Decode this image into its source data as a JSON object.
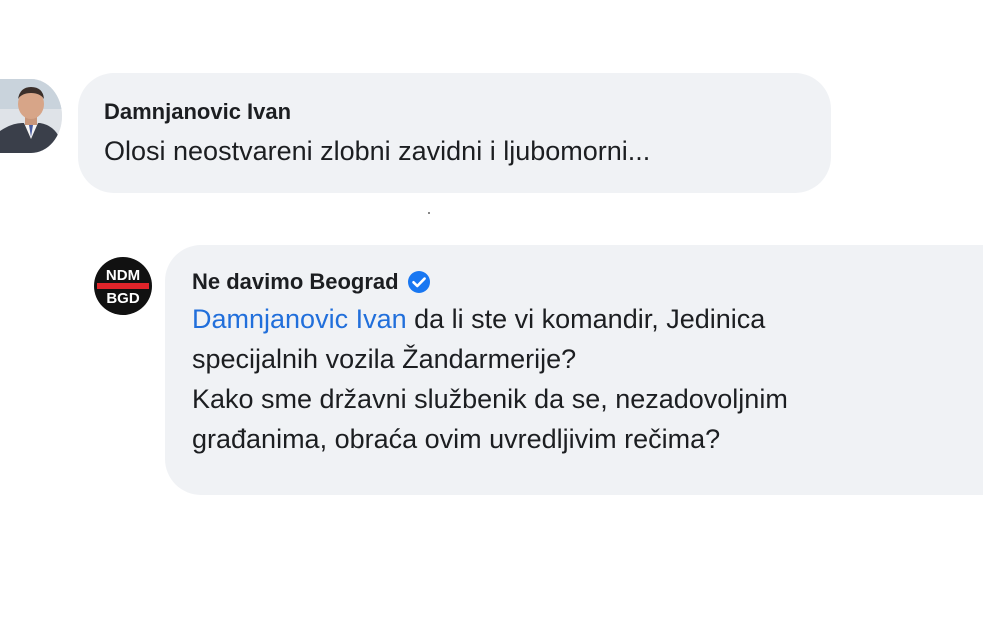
{
  "comments": [
    {
      "author": "Damnjanovic Ivan",
      "text": "Olosi neostvareni zlobni zavidni i ljubomorni..."
    },
    {
      "author": "Ne davimo Beograd",
      "verified": true,
      "avatar_text": [
        "NDM",
        "BGD"
      ],
      "mention": "Damnjanovic Ivan",
      "line1_rest": " da li ste vi komandir, Jedinica",
      "line2": "specijalnih vozila Žandarmerije?",
      "line3": "Kako sme državni službenik da se, nezadovoljnim",
      "line4": "građanima, obraća ovim uvredljivim rečima?"
    }
  ],
  "colors": {
    "bubble": "#f0f2f5",
    "mention": "#216fdb",
    "verified": "#1877f2",
    "ndm_red": "#e0242a"
  }
}
